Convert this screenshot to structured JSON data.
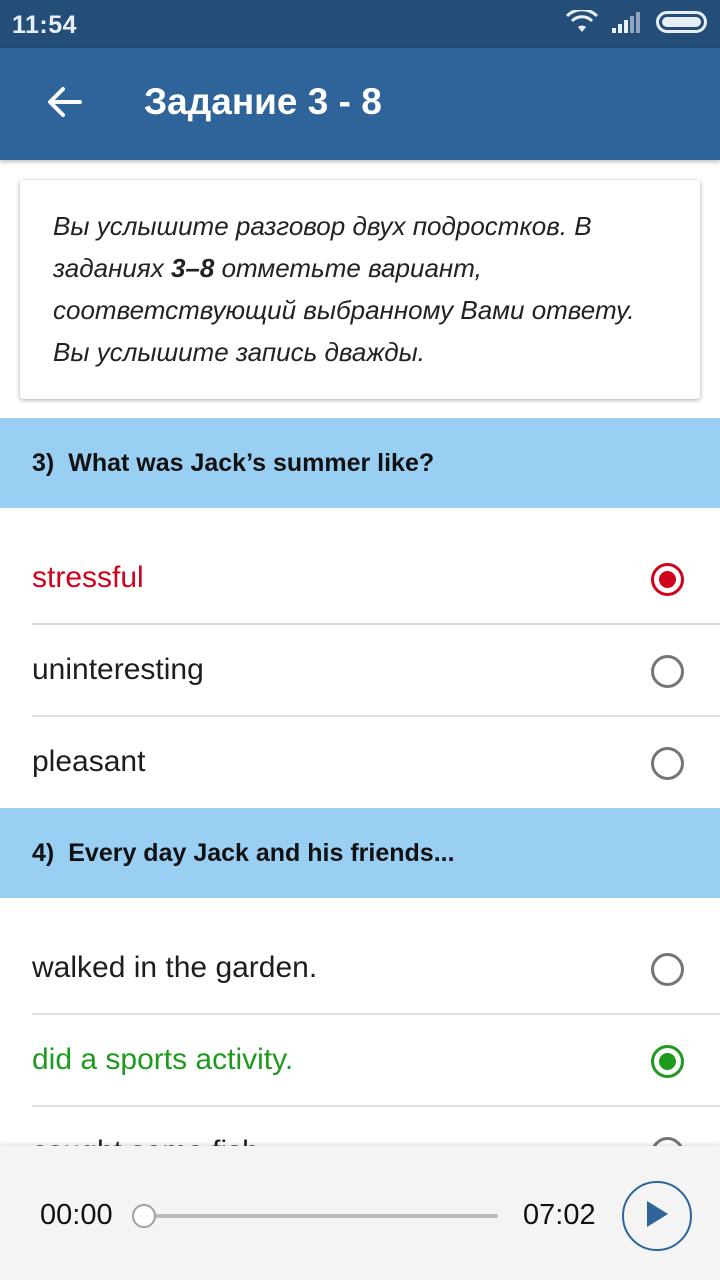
{
  "status_bar": {
    "time": "11:54",
    "wifi_icon": "wifi-icon",
    "signal_icon": "signal-icon",
    "battery_icon": "battery-icon"
  },
  "app_bar": {
    "back_icon": "arrow-back-icon",
    "title": "Задание 3 - 8"
  },
  "instruction": {
    "line1": "Вы услышите разговор двух подростков. В",
    "line2_pre": "заданиях ",
    "line2_bold": "3–8",
    "line2_post": " отметьте вариант,",
    "line3": "соответствующий выбранному Вами ответу.",
    "line4": "Вы услышите запись дважды."
  },
  "questions": [
    {
      "number": "3)",
      "text": "What was Jack’s summer like?",
      "options": [
        {
          "label": "stressful",
          "state": "selected-wrong"
        },
        {
          "label": "uninteresting",
          "state": "unselected"
        },
        {
          "label": "pleasant",
          "state": "unselected"
        }
      ]
    },
    {
      "number": "4)",
      "text": "Every day Jack and his friends...",
      "options": [
        {
          "label": "walked in the garden.",
          "state": "unselected"
        },
        {
          "label": "did a sports activity.",
          "state": "selected-correct"
        },
        {
          "label": "caught some fish.",
          "state": "unselected"
        }
      ]
    }
  ],
  "player": {
    "current_time": "00:00",
    "total_time": "07:02",
    "progress": 0,
    "play_icon": "play-icon"
  },
  "colors": {
    "status_bar": "#244e77",
    "app_bar": "#2e6499",
    "question_bg": "#9acff4",
    "wrong": "#d0021b",
    "correct": "#1e9a1e"
  }
}
